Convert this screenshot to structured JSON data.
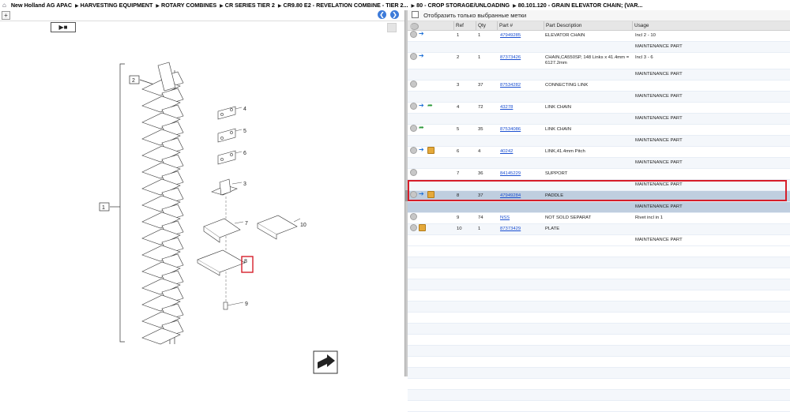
{
  "breadcrumb": {
    "items": [
      "New Holland AG APAC",
      "HARVESTING EQUIPMENT",
      "ROTARY COMBINES",
      "CR SERIES TIER 2",
      "CR9.80 E2 - REVELATION COMBINE - TIER 2...",
      "80 - CROP STORAGE/UNLOADING",
      "80.101.120 - GRAIN ELEVATOR CHAIN; (VAR..."
    ]
  },
  "diagram": {
    "callouts": [
      "1",
      "2",
      "3",
      "4",
      "5",
      "6",
      "7",
      "8",
      "9",
      "10"
    ]
  },
  "filter": {
    "label": "Отобразить только выбранные метки"
  },
  "table": {
    "headers": {
      "ref": "Ref",
      "qty": "Qty",
      "part": "Part #",
      "desc": "Part Description",
      "usage": "Usage"
    },
    "rows": [
      {
        "ref": "1",
        "qty": "1",
        "part": "47949285",
        "desc": "ELEVATOR CHAIN",
        "usage": "Incl 2 - 10",
        "sub": "MAINTENANCE PART",
        "icons": [
          "arrow"
        ]
      },
      {
        "ref": "2",
        "qty": "1",
        "part": "87373426",
        "desc": "CHAIN,CA550SP, 148 Links x 41.4mm = 6127.2mm",
        "usage": "Incl 3 - 6",
        "sub": "MAINTENANCE PART",
        "icons": [
          "arrow"
        ]
      },
      {
        "ref": "3",
        "qty": "37",
        "part": "87534282",
        "desc": "CONNECTING LINK",
        "usage": "",
        "sub": "MAINTENANCE PART",
        "icons": []
      },
      {
        "ref": "4",
        "qty": "72",
        "part": "43278",
        "desc": "LINK CHAIN",
        "usage": "",
        "sub": "MAINTENANCE PART",
        "icons": [
          "arrow",
          "green"
        ]
      },
      {
        "ref": "5",
        "qty": "35",
        "part": "87534086",
        "desc": "LINK CHAIN",
        "usage": "",
        "sub": "MAINTENANCE PART",
        "icons": [
          "green"
        ]
      },
      {
        "ref": "6",
        "qty": "4",
        "part": "40242",
        "desc": "LINK,41.4mm Pitch",
        "usage": "",
        "sub": "MAINTENANCE PART",
        "icons": [
          "arrow",
          "box"
        ]
      },
      {
        "ref": "7",
        "qty": "36",
        "part": "84145229",
        "desc": "SUPPORT",
        "usage": "",
        "sub": "MAINTENANCE PART",
        "icons": []
      },
      {
        "ref": "8",
        "qty": "37",
        "part": "47949284",
        "desc": "PADDLE",
        "usage": "",
        "sub": "MAINTENANCE PART",
        "icons": [
          "arrow",
          "box"
        ],
        "selected": true
      },
      {
        "ref": "9",
        "qty": "74",
        "part": "NSS",
        "desc": "NOT SOLD SEPARAT",
        "usage": "Rivet incl in 1",
        "sub": "",
        "icons": []
      },
      {
        "ref": "10",
        "qty": "1",
        "part": "87373429",
        "desc": "PLATE",
        "usage": "",
        "sub": "MAINTENANCE PART",
        "icons": [
          "box"
        ]
      }
    ]
  },
  "colors": {
    "link": "#1a4fd1",
    "highlight_row": "#bfcedf",
    "highlight_outline": "#d61e2a",
    "nav_button": "#3d7bd9"
  }
}
